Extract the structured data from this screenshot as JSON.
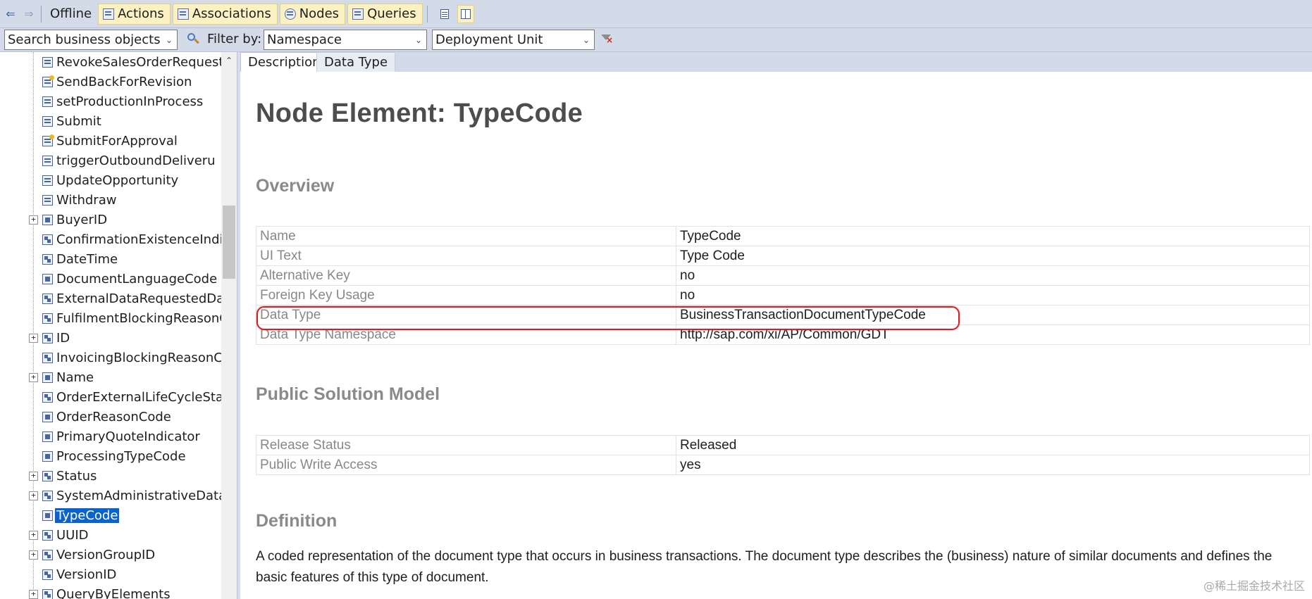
{
  "toolbar": {
    "back_icon": "arrow-left-icon",
    "forward_icon": "arrow-right-icon",
    "offline": "Offline",
    "actions": "Actions",
    "associations": "Associations",
    "nodes": "Nodes",
    "queries": "Queries"
  },
  "filter": {
    "search_value": "Search business objects",
    "filter_by_label": "Filter by:",
    "namespace_value": "Namespace",
    "deployment_unit_value": "Deployment Unit"
  },
  "tree": {
    "items": [
      {
        "label": "RevokeSalesOrderRequest",
        "icon": "action-icon"
      },
      {
        "label": "SendBackForRevision",
        "icon": "action-warning-icon"
      },
      {
        "label": "setProductionInProcess",
        "icon": "action-icon"
      },
      {
        "label": "Submit",
        "icon": "action-icon"
      },
      {
        "label": "SubmitForApproval",
        "icon": "action-warning-icon"
      },
      {
        "label": "triggerOutboundDeliveru",
        "icon": "action-icon"
      },
      {
        "label": "UpdateOpportunity",
        "icon": "action-icon"
      },
      {
        "label": "Withdraw",
        "icon": "action-icon"
      },
      {
        "label": "BuyerID",
        "icon": "element-icon"
      },
      {
        "label": "ConfirmationExistenceIndicator",
        "icon": "association-icon"
      },
      {
        "label": "DateTime",
        "icon": "association-icon"
      },
      {
        "label": "DocumentLanguageCode",
        "icon": "element-icon"
      },
      {
        "label": "ExternalDataRequestedDateTime",
        "icon": "association-icon"
      },
      {
        "label": "FulfilmentBlockingReasonCode",
        "icon": "association-icon"
      },
      {
        "label": "ID",
        "icon": "association-icon"
      },
      {
        "label": "InvoicingBlockingReasonCode",
        "icon": "association-icon"
      },
      {
        "label": "Name",
        "icon": "element-icon"
      },
      {
        "label": "OrderExternalLifeCycleStatusCode",
        "icon": "association-icon"
      },
      {
        "label": "OrderReasonCode",
        "icon": "element-icon"
      },
      {
        "label": "PrimaryQuoteIndicator",
        "icon": "element-icon"
      },
      {
        "label": "ProcessingTypeCode",
        "icon": "element-icon"
      },
      {
        "label": "Status",
        "icon": "association-icon"
      },
      {
        "label": "SystemAdministrativeData",
        "icon": "association-icon"
      },
      {
        "label": "TypeCode",
        "icon": "element-icon"
      },
      {
        "label": "UUID",
        "icon": "association-icon"
      },
      {
        "label": "VersionGroupID",
        "icon": "association-icon"
      },
      {
        "label": "VersionID",
        "icon": "association-icon"
      },
      {
        "label": "QueryByElements",
        "icon": "association-icon"
      }
    ]
  },
  "tabs": {
    "description": "Description",
    "data_type": "Data Type"
  },
  "content": {
    "title": "Node Element: TypeCode",
    "overview_heading": "Overview",
    "overview": [
      {
        "key": "Name",
        "value": "TypeCode"
      },
      {
        "key": "UI Text",
        "value": "Type Code"
      },
      {
        "key": "Alternative Key",
        "value": "no"
      },
      {
        "key": "Foreign Key Usage",
        "value": "no"
      },
      {
        "key": "Data Type",
        "value": "BusinessTransactionDocumentTypeCode"
      },
      {
        "key": "Data Type Namespace",
        "value": "http://sap.com/xi/AP/Common/GDT"
      }
    ],
    "psm_heading": "Public Solution Model",
    "psm": [
      {
        "key": "Release Status",
        "value": "Released"
      },
      {
        "key": "Public Write Access",
        "value": "yes"
      }
    ],
    "definition_heading": "Definition",
    "definition_text": "A coded representation of the document type that occurs in business transactions. The document type describes the (business) nature of similar documents and defines the basic features of this type of document."
  },
  "watermark": "@稀土掘金技术社区",
  "colors": {
    "toolbar_bg": "#d3dbe9",
    "button_bg": "#fbf1c2",
    "selection": "#0a63c9",
    "highlight_ring": "#d81e1e"
  }
}
